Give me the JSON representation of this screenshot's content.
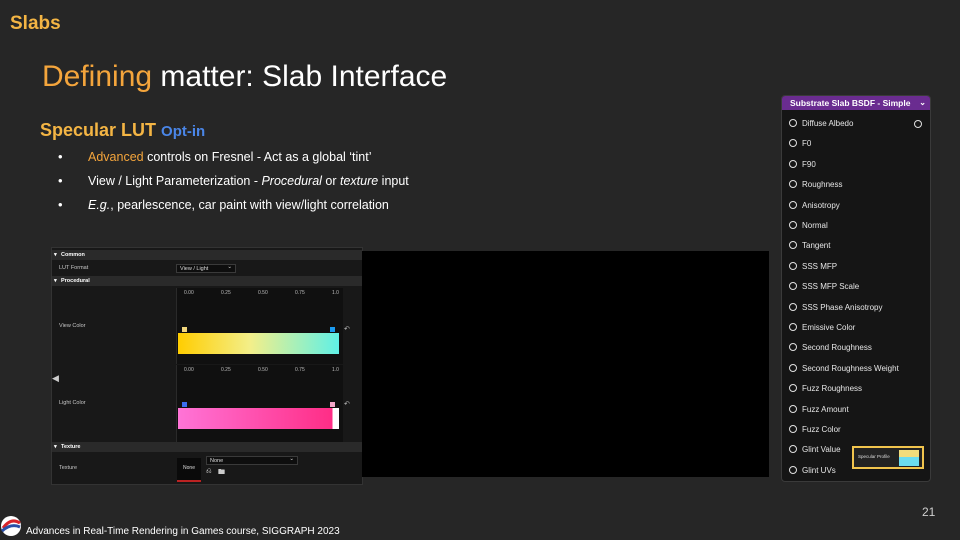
{
  "slide": {
    "section": "Slabs",
    "title_highlight": "Defining",
    "title_rest": " matter: Slab Interface",
    "subtitle": "Specular LUT",
    "subtitle_tag": "Opt-in",
    "bullet1_highlight": "Advanced",
    "bullet1_rest": " controls on Fresnel - Act as a global ‘tint’",
    "bullet2_start": "View / Light Parameterization - ",
    "bullet2_em1": "Procedural",
    "bullet2_mid": " or ",
    "bullet2_em2": "texture",
    "bullet2_end": " input",
    "bullet3_em": "E.g.",
    "bullet3_rest": ", pearlescence, car paint with view/light correlation",
    "page_number": "21",
    "footer": "Advances in Real-Time Rendering in Games course, SIGGRAPH  2023"
  },
  "lut_panel": {
    "category_common": "Common",
    "lut_format_label": "LUT Format",
    "lut_format_value": "View / Light",
    "category_procedural": "Procedural",
    "view_color_label": "View Color",
    "light_color_label": "Light Color",
    "ticks": [
      "0.00",
      "0.25",
      "0.50",
      "0.75",
      "1.0"
    ],
    "reset_icon": "reset-arrow-icon",
    "category_texture": "Texture",
    "texture_label": "Texture",
    "texture_thumb": "None",
    "texture_value": "None",
    "view_gradient": [
      "#ffcd00",
      "#f3ef8a",
      "#5ff0e6"
    ],
    "light_gradient": [
      "#ff74d7",
      "#ff2d86"
    ]
  },
  "node": {
    "title": "Substrate Slab BSDF - Simple",
    "pins": [
      "Diffuse Albedo",
      "F0",
      "F90",
      "Roughness",
      "Anisotropy",
      "Normal",
      "Tangent",
      "SSS MFP",
      "SSS MFP Scale",
      "SSS Phase Anisotropy",
      "Emissive Color",
      "Second Roughness",
      "Second Roughness Weight",
      "Fuzz Roughness",
      "Fuzz Amount",
      "Fuzz Color",
      "Glint Value",
      "Glint UVs"
    ],
    "specular_profile_label": "Specular Profile",
    "header_color": "#6a2c90",
    "highlight_color": "#f1c44d"
  },
  "colors": {
    "accent": "#f4a53c",
    "section": "#f4b544",
    "opt_in": "#4a86e8"
  }
}
